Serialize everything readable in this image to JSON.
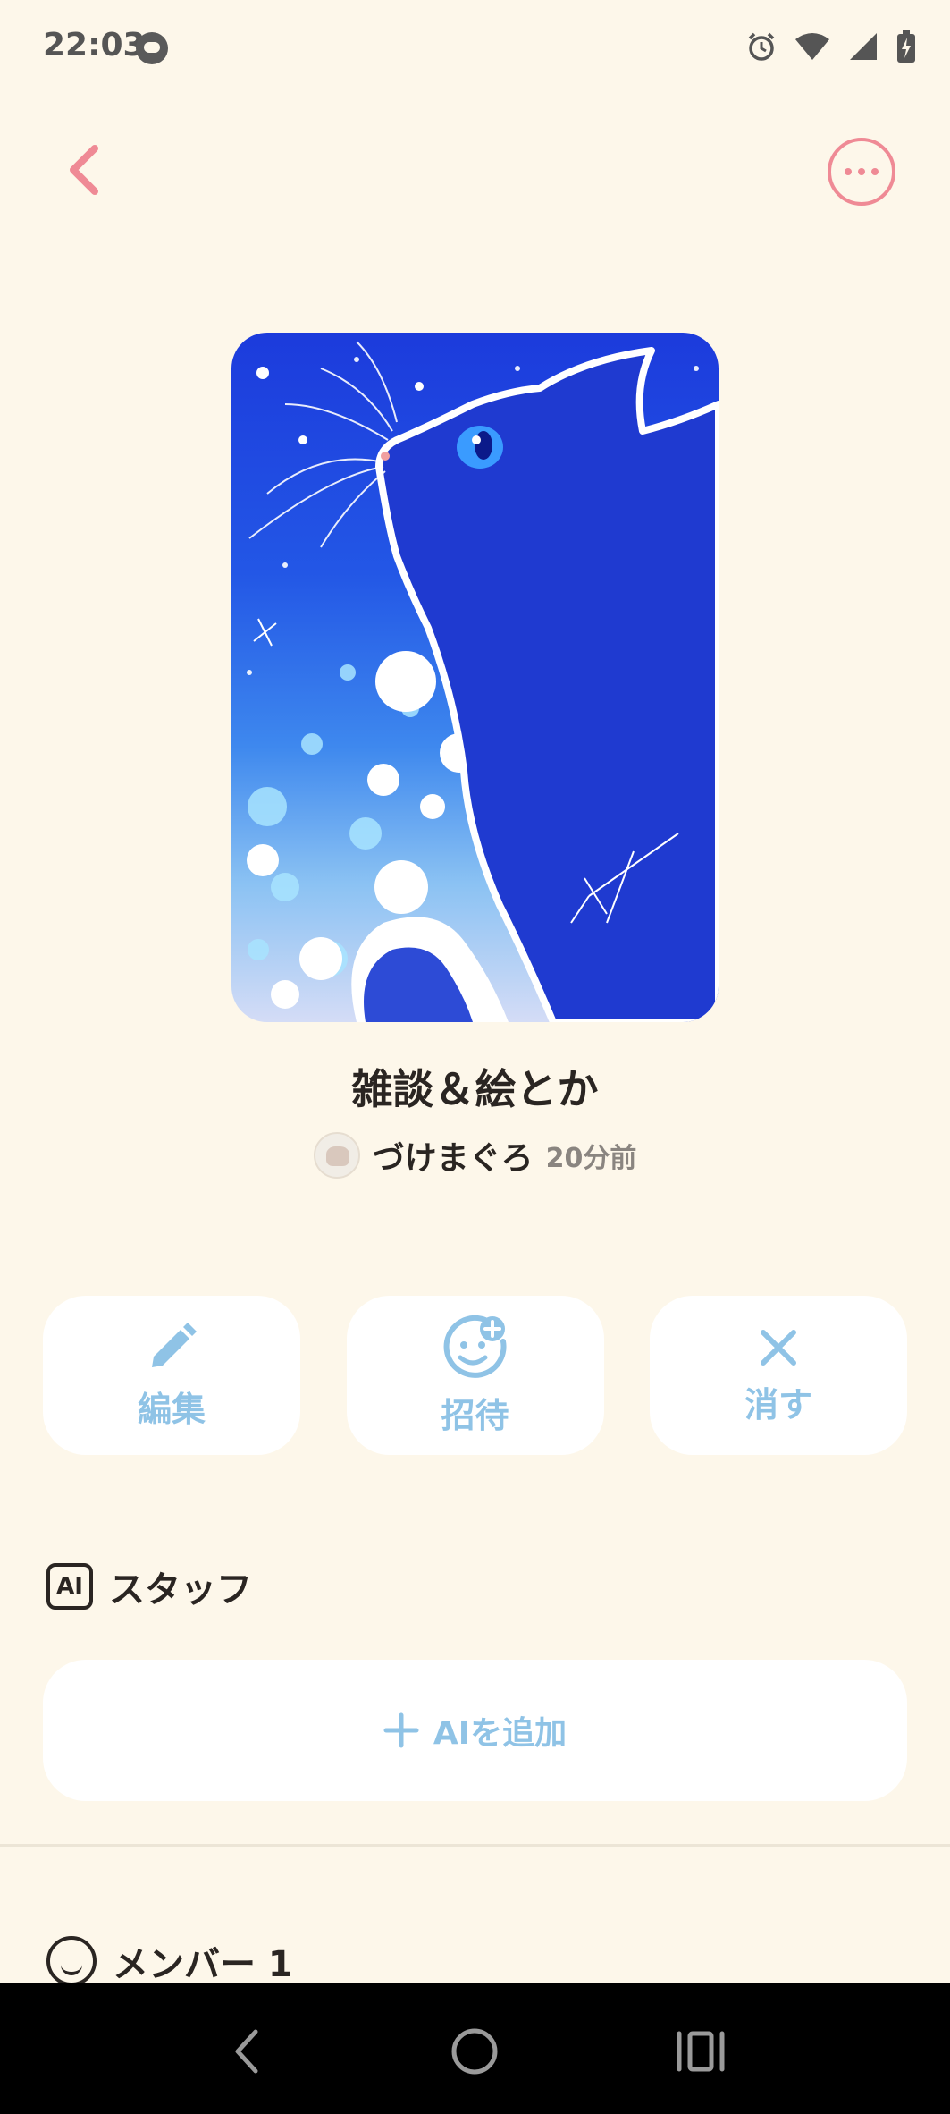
{
  "status_bar": {
    "time": "22:03",
    "icons": [
      "game-controller-icon",
      "alarm-icon",
      "wifi-icon",
      "signal-icon",
      "battery-charging-icon"
    ]
  },
  "nav": {
    "back_icon": "chevron-left-icon",
    "more_icon": "more-horizontal-icon",
    "accent_color": "#ef8a95"
  },
  "room": {
    "title": "雑談＆絵とか",
    "owner_name": "づけまぐろ",
    "time_ago": "20分前",
    "cover_image": "blue-cat-starry-illustration"
  },
  "actions": [
    {
      "label": "編集",
      "icon": "pencil-icon"
    },
    {
      "label": "招待",
      "icon": "add-person-icon"
    },
    {
      "label": "消す",
      "icon": "close-icon"
    }
  ],
  "staff": {
    "badge": "AI",
    "title": "スタッフ",
    "add_label": "AIを追加",
    "accent_color": "#8fc3e6"
  },
  "members": {
    "title": "メンバー 1"
  },
  "system_nav": [
    "back-icon",
    "home-icon",
    "recents-icon"
  ]
}
